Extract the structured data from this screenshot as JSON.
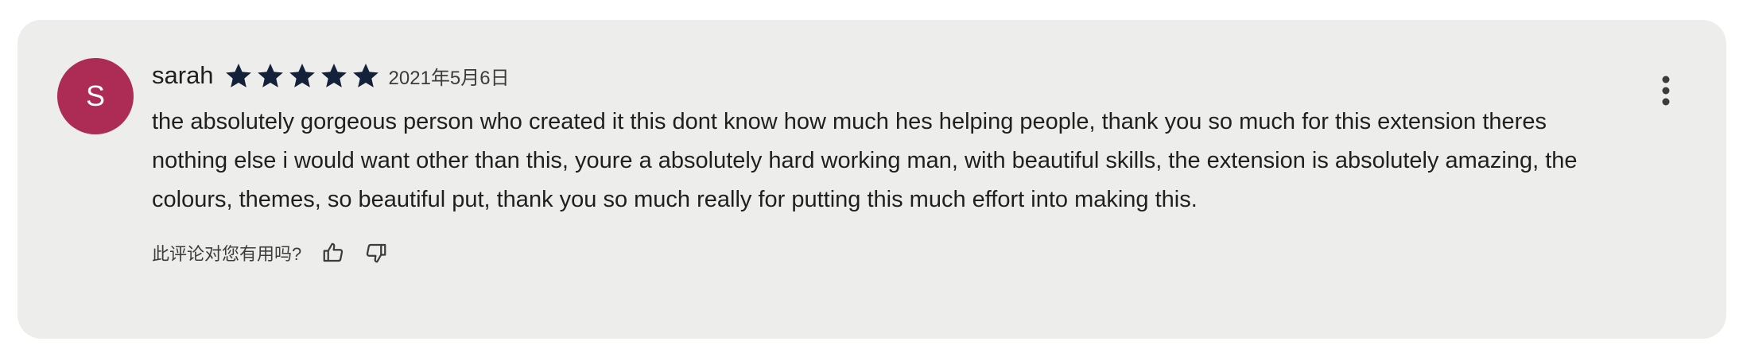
{
  "review": {
    "avatar_letter": "S",
    "avatar_color": "#ad2c55",
    "author": "sarah",
    "rating": 5,
    "max_rating": 5,
    "date": "2021年5月6日",
    "text": "the absolutely gorgeous person who created it this dont know how much hes helping people, thank you so much for this extension theres nothing else i would want other than this, youre a absolutely hard working man, with beautiful skills, the extension is absolutely amazing, the colours, themes, so beautiful put, thank you so much really for putting this much effort into making this."
  },
  "helpful": {
    "label": "此评论对您有用吗?",
    "thumbs_up_icon": "thumbs-up-icon",
    "thumbs_down_icon": "thumbs-down-icon"
  },
  "menu": {
    "icon": "more-vert-icon"
  },
  "colors": {
    "card_background": "#edeeeb",
    "star_color": "#14213a",
    "text_color": "#1f1f1f"
  }
}
